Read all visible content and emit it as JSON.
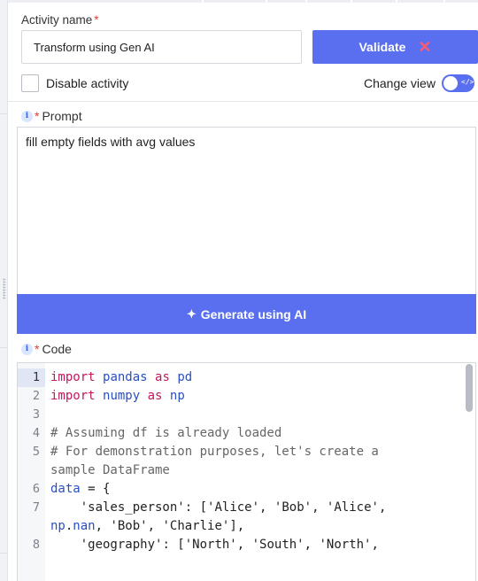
{
  "form": {
    "activity_name_label": "Activity name",
    "required_mark": "*",
    "activity_name_value": "Transform using Gen AI",
    "validate_label": "Validate",
    "validate_error_icon": "✕",
    "disable_activity_label": "Disable activity",
    "disable_activity_checked": false,
    "change_view_label": "Change view",
    "change_view_on": true,
    "toggle_glyph": "</>"
  },
  "prompt": {
    "label": "Prompt",
    "info_glyph": "i",
    "required_mark": "*",
    "text": "fill empty fields with avg values",
    "generate_label": "Generate using AI",
    "generate_icon": "✦"
  },
  "code": {
    "label": "Code",
    "info_glyph": "i",
    "required_mark": "*",
    "active_line": 1,
    "lines": [
      {
        "number": "1",
        "tokens": [
          {
            "t": "import",
            "c": "kw"
          },
          {
            "t": " "
          },
          {
            "t": "pandas",
            "c": "id"
          },
          {
            "t": " "
          },
          {
            "t": "as",
            "c": "kw"
          },
          {
            "t": " "
          },
          {
            "t": "pd",
            "c": "id"
          }
        ]
      },
      {
        "number": "2",
        "tokens": [
          {
            "t": "import",
            "c": "kw"
          },
          {
            "t": " "
          },
          {
            "t": "numpy",
            "c": "id"
          },
          {
            "t": " "
          },
          {
            "t": "as",
            "c": "kw"
          },
          {
            "t": " "
          },
          {
            "t": "np",
            "c": "id"
          }
        ]
      },
      {
        "number": "3",
        "tokens": []
      },
      {
        "number": "4",
        "tokens": [
          {
            "t": "# Assuming df is already loaded",
            "c": "cm"
          }
        ]
      },
      {
        "number": "5",
        "tokens": [
          {
            "t": "# For demonstration purposes, let's create a",
            "c": "cm"
          }
        ]
      },
      {
        "number": "",
        "tokens": [
          {
            "t": "sample DataFrame",
            "c": "cm"
          }
        ]
      },
      {
        "number": "6",
        "tokens": [
          {
            "t": "data",
            "c": "id"
          },
          {
            "t": " = {"
          }
        ]
      },
      {
        "number": "7",
        "tokens": [
          {
            "t": "    "
          },
          {
            "t": "'sales_person'",
            "c": "st"
          },
          {
            "t": ": ["
          },
          {
            "t": "'Alice'",
            "c": "st"
          },
          {
            "t": ", "
          },
          {
            "t": "'Bob'",
            "c": "st"
          },
          {
            "t": ", "
          },
          {
            "t": "'Alice'",
            "c": "st"
          },
          {
            "t": ","
          }
        ]
      },
      {
        "number": "",
        "tokens": [
          {
            "t": "np",
            "c": "id"
          },
          {
            "t": "."
          },
          {
            "t": "nan",
            "c": "id"
          },
          {
            "t": ", "
          },
          {
            "t": "'Bob'",
            "c": "st"
          },
          {
            "t": ", "
          },
          {
            "t": "'Charlie'",
            "c": "st"
          },
          {
            "t": "],"
          }
        ]
      },
      {
        "number": "8",
        "tokens": [
          {
            "t": "    "
          },
          {
            "t": "'geography'",
            "c": "st"
          },
          {
            "t": ": ["
          },
          {
            "t": "'North'",
            "c": "st"
          },
          {
            "t": ", "
          },
          {
            "t": "'South'",
            "c": "st"
          },
          {
            "t": ", "
          },
          {
            "t": "'North'",
            "c": "st"
          },
          {
            "t": ","
          }
        ]
      }
    ]
  },
  "colors": {
    "accent": "#5a6ff0",
    "error": "#ff5a6e",
    "required": "#e23c3c",
    "keyword": "#c2185b",
    "identifier": "#2b4fc2"
  }
}
